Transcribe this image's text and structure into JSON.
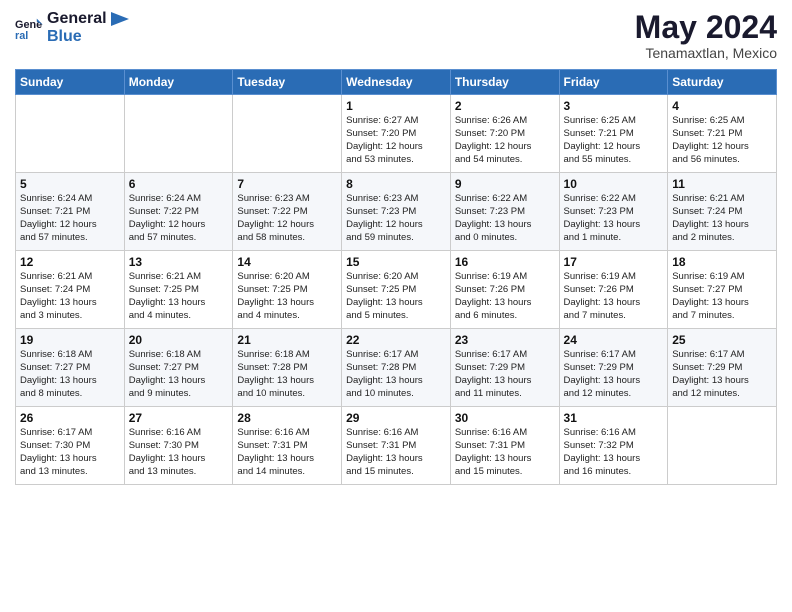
{
  "logo": {
    "line1": "General",
    "line2": "Blue"
  },
  "title": "May 2024",
  "location": "Tenamaxtlan, Mexico",
  "weekdays": [
    "Sunday",
    "Monday",
    "Tuesday",
    "Wednesday",
    "Thursday",
    "Friday",
    "Saturday"
  ],
  "weeks": [
    [
      {
        "day": "",
        "info": ""
      },
      {
        "day": "",
        "info": ""
      },
      {
        "day": "",
        "info": ""
      },
      {
        "day": "1",
        "info": "Sunrise: 6:27 AM\nSunset: 7:20 PM\nDaylight: 12 hours\nand 53 minutes."
      },
      {
        "day": "2",
        "info": "Sunrise: 6:26 AM\nSunset: 7:20 PM\nDaylight: 12 hours\nand 54 minutes."
      },
      {
        "day": "3",
        "info": "Sunrise: 6:25 AM\nSunset: 7:21 PM\nDaylight: 12 hours\nand 55 minutes."
      },
      {
        "day": "4",
        "info": "Sunrise: 6:25 AM\nSunset: 7:21 PM\nDaylight: 12 hours\nand 56 minutes."
      }
    ],
    [
      {
        "day": "5",
        "info": "Sunrise: 6:24 AM\nSunset: 7:21 PM\nDaylight: 12 hours\nand 57 minutes."
      },
      {
        "day": "6",
        "info": "Sunrise: 6:24 AM\nSunset: 7:22 PM\nDaylight: 12 hours\nand 57 minutes."
      },
      {
        "day": "7",
        "info": "Sunrise: 6:23 AM\nSunset: 7:22 PM\nDaylight: 12 hours\nand 58 minutes."
      },
      {
        "day": "8",
        "info": "Sunrise: 6:23 AM\nSunset: 7:23 PM\nDaylight: 12 hours\nand 59 minutes."
      },
      {
        "day": "9",
        "info": "Sunrise: 6:22 AM\nSunset: 7:23 PM\nDaylight: 13 hours\nand 0 minutes."
      },
      {
        "day": "10",
        "info": "Sunrise: 6:22 AM\nSunset: 7:23 PM\nDaylight: 13 hours\nand 1 minute."
      },
      {
        "day": "11",
        "info": "Sunrise: 6:21 AM\nSunset: 7:24 PM\nDaylight: 13 hours\nand 2 minutes."
      }
    ],
    [
      {
        "day": "12",
        "info": "Sunrise: 6:21 AM\nSunset: 7:24 PM\nDaylight: 13 hours\nand 3 minutes."
      },
      {
        "day": "13",
        "info": "Sunrise: 6:21 AM\nSunset: 7:25 PM\nDaylight: 13 hours\nand 4 minutes."
      },
      {
        "day": "14",
        "info": "Sunrise: 6:20 AM\nSunset: 7:25 PM\nDaylight: 13 hours\nand 4 minutes."
      },
      {
        "day": "15",
        "info": "Sunrise: 6:20 AM\nSunset: 7:25 PM\nDaylight: 13 hours\nand 5 minutes."
      },
      {
        "day": "16",
        "info": "Sunrise: 6:19 AM\nSunset: 7:26 PM\nDaylight: 13 hours\nand 6 minutes."
      },
      {
        "day": "17",
        "info": "Sunrise: 6:19 AM\nSunset: 7:26 PM\nDaylight: 13 hours\nand 7 minutes."
      },
      {
        "day": "18",
        "info": "Sunrise: 6:19 AM\nSunset: 7:27 PM\nDaylight: 13 hours\nand 7 minutes."
      }
    ],
    [
      {
        "day": "19",
        "info": "Sunrise: 6:18 AM\nSunset: 7:27 PM\nDaylight: 13 hours\nand 8 minutes."
      },
      {
        "day": "20",
        "info": "Sunrise: 6:18 AM\nSunset: 7:27 PM\nDaylight: 13 hours\nand 9 minutes."
      },
      {
        "day": "21",
        "info": "Sunrise: 6:18 AM\nSunset: 7:28 PM\nDaylight: 13 hours\nand 10 minutes."
      },
      {
        "day": "22",
        "info": "Sunrise: 6:17 AM\nSunset: 7:28 PM\nDaylight: 13 hours\nand 10 minutes."
      },
      {
        "day": "23",
        "info": "Sunrise: 6:17 AM\nSunset: 7:29 PM\nDaylight: 13 hours\nand 11 minutes."
      },
      {
        "day": "24",
        "info": "Sunrise: 6:17 AM\nSunset: 7:29 PM\nDaylight: 13 hours\nand 12 minutes."
      },
      {
        "day": "25",
        "info": "Sunrise: 6:17 AM\nSunset: 7:29 PM\nDaylight: 13 hours\nand 12 minutes."
      }
    ],
    [
      {
        "day": "26",
        "info": "Sunrise: 6:17 AM\nSunset: 7:30 PM\nDaylight: 13 hours\nand 13 minutes."
      },
      {
        "day": "27",
        "info": "Sunrise: 6:16 AM\nSunset: 7:30 PM\nDaylight: 13 hours\nand 13 minutes."
      },
      {
        "day": "28",
        "info": "Sunrise: 6:16 AM\nSunset: 7:31 PM\nDaylight: 13 hours\nand 14 minutes."
      },
      {
        "day": "29",
        "info": "Sunrise: 6:16 AM\nSunset: 7:31 PM\nDaylight: 13 hours\nand 15 minutes."
      },
      {
        "day": "30",
        "info": "Sunrise: 6:16 AM\nSunset: 7:31 PM\nDaylight: 13 hours\nand 15 minutes."
      },
      {
        "day": "31",
        "info": "Sunrise: 6:16 AM\nSunset: 7:32 PM\nDaylight: 13 hours\nand 16 minutes."
      },
      {
        "day": "",
        "info": ""
      }
    ]
  ]
}
